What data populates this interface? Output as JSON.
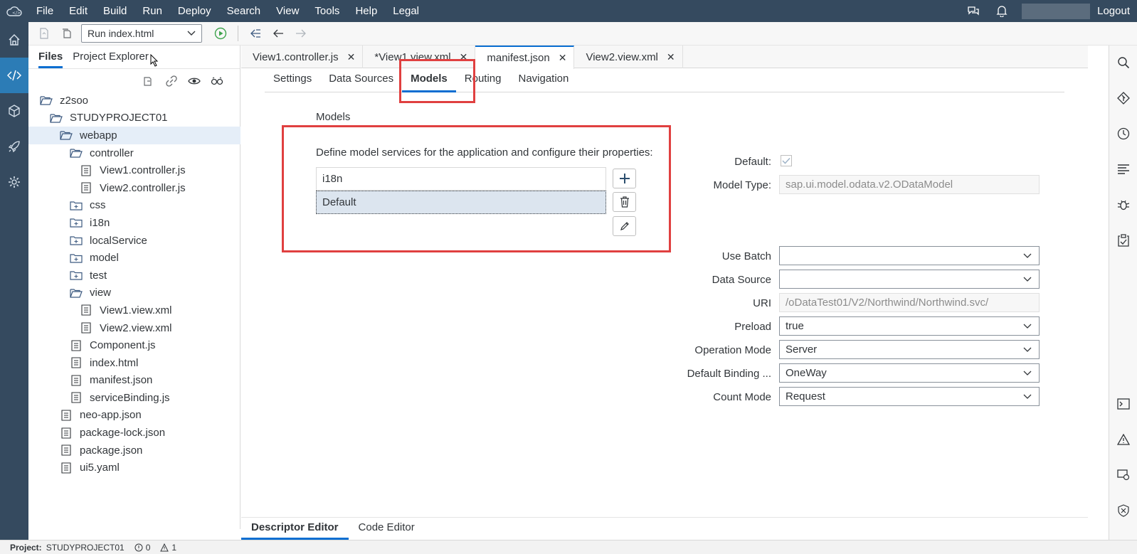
{
  "menubar": {
    "items": [
      "File",
      "Edit",
      "Build",
      "Run",
      "Deploy",
      "Search",
      "View",
      "Tools",
      "Help",
      "Legal"
    ],
    "logout": "Logout"
  },
  "toolbar": {
    "run_config": "Run index.html"
  },
  "file_pane": {
    "tabs": [
      "Files",
      "Project Explorer"
    ],
    "tree": [
      {
        "label": "z2soo",
        "icon": "folder-open-icon",
        "indent": 0
      },
      {
        "label": "STUDYPROJECT01",
        "icon": "folder-open-icon",
        "indent": 1
      },
      {
        "label": "webapp",
        "icon": "folder-open-icon",
        "indent": 2,
        "selected": true
      },
      {
        "label": "controller",
        "icon": "folder-open-icon",
        "indent": 3
      },
      {
        "label": "View1.controller.js",
        "icon": "file-icon",
        "indent": 4
      },
      {
        "label": "View2.controller.js",
        "icon": "file-icon",
        "indent": 4
      },
      {
        "label": "css",
        "icon": "folder-closed-icon",
        "indent": 3
      },
      {
        "label": "i18n",
        "icon": "folder-closed-icon",
        "indent": 3
      },
      {
        "label": "localService",
        "icon": "folder-closed-icon",
        "indent": 3
      },
      {
        "label": "model",
        "icon": "folder-closed-icon",
        "indent": 3
      },
      {
        "label": "test",
        "icon": "folder-closed-icon",
        "indent": 3
      },
      {
        "label": "view",
        "icon": "folder-open-icon",
        "indent": 3
      },
      {
        "label": "View1.view.xml",
        "icon": "file-icon",
        "indent": 4
      },
      {
        "label": "View2.view.xml",
        "icon": "file-icon",
        "indent": 4
      },
      {
        "label": "Component.js",
        "icon": "file-icon",
        "indent": 3
      },
      {
        "label": "index.html",
        "icon": "file-icon",
        "indent": 3
      },
      {
        "label": "manifest.json",
        "icon": "file-icon",
        "indent": 3
      },
      {
        "label": "serviceBinding.js",
        "icon": "file-icon",
        "indent": 3
      },
      {
        "label": "neo-app.json",
        "icon": "file-icon",
        "indent": 2
      },
      {
        "label": "package-lock.json",
        "icon": "file-icon",
        "indent": 2
      },
      {
        "label": "package.json",
        "icon": "file-icon",
        "indent": 2
      },
      {
        "label": "ui5.yaml",
        "icon": "file-icon",
        "indent": 2
      }
    ]
  },
  "editor_tabs": [
    {
      "label": "View1.controller.js",
      "active": false
    },
    {
      "label": "*View1.view.xml",
      "active": false
    },
    {
      "label": "manifest.json",
      "active": true
    },
    {
      "label": "View2.view.xml",
      "active": false
    }
  ],
  "sub_tabs": [
    {
      "label": "Settings",
      "active": false
    },
    {
      "label": "Data Sources",
      "active": false
    },
    {
      "label": "Models",
      "active": true
    },
    {
      "label": "Routing",
      "active": false
    },
    {
      "label": "Navigation",
      "active": false
    }
  ],
  "models": {
    "title": "Models",
    "description": "Define model services for the application and configure their properties:",
    "list": [
      {
        "label": "i18n",
        "selected": false
      },
      {
        "label": "Default",
        "selected": true
      }
    ]
  },
  "form": {
    "default_label": "Default:",
    "default_checked": true,
    "model_type_label": "Model Type:",
    "model_type_value": "sap.ui.model.odata.v2.ODataModel",
    "use_batch_label": "Use Batch",
    "use_batch_value": "",
    "data_source_label": "Data Source",
    "data_source_value": "",
    "uri_label": "URI",
    "uri_value": "/oDataTest01/V2/Northwind/Northwind.svc/",
    "preload_label": "Preload",
    "preload_value": "true",
    "operation_mode_label": "Operation Mode",
    "operation_mode_value": "Server",
    "default_binding_label": "Default Binding ...",
    "default_binding_value": "OneWay",
    "count_mode_label": "Count Mode",
    "count_mode_value": "Request"
  },
  "bottom_tabs": [
    {
      "label": "Descriptor Editor",
      "active": true
    },
    {
      "label": "Code Editor",
      "active": false
    }
  ],
  "statusbar": {
    "project_label": "Project:",
    "project_name": "STUDYPROJECT01",
    "errors": "0",
    "warnings": "1"
  },
  "colors": {
    "shell": "#354a5f",
    "accent": "#0a6ed1",
    "highlight_box": "#e04040"
  }
}
